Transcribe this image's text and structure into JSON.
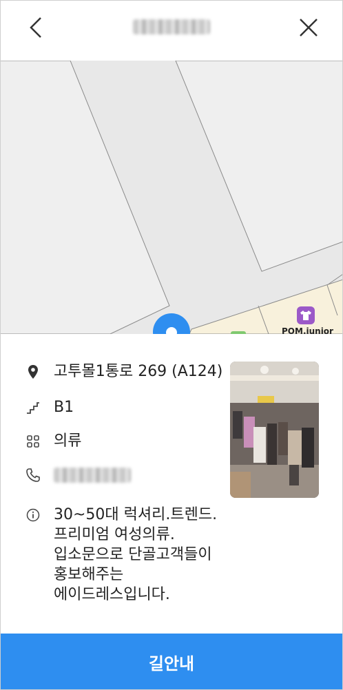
{
  "header": {
    "back_icon": "chevron-left-icon",
    "close_icon": "close-icon"
  },
  "map": {
    "store_label": "POM.junior",
    "store_icon": "tshirt-icon",
    "store_icon_color": "#9b59c8",
    "pin_color": "#2e8ef0"
  },
  "info": {
    "address": "고투몰1통로 269 (A124)",
    "floor": "B1",
    "category": "의류",
    "description": "30~50대 럭셔리.트렌드.\n프리미엄 여성의류.\n입소문으로 단골고객들이\n홍보해주는\n에이드레스입니다.",
    "icons": [
      "location-pin-icon",
      "stairs-icon",
      "category-grid-icon",
      "phone-icon",
      "info-icon"
    ]
  },
  "navigate_button": {
    "label": "길안내",
    "color": "#2e8ef0"
  }
}
